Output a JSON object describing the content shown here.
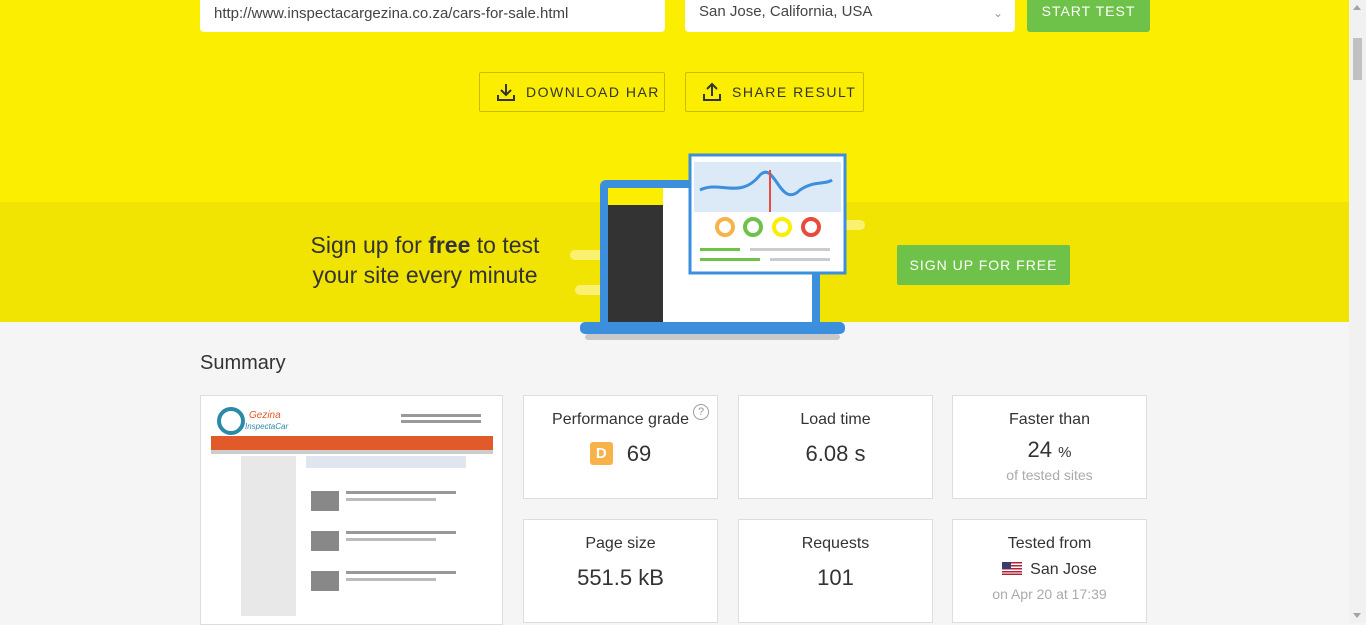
{
  "test_form": {
    "url_value": "http://www.inspectacargezina.co.za/cars-for-sale.html",
    "location": "San Jose, California, USA",
    "start_label": "START TEST"
  },
  "actions": {
    "download_label": "DOWNLOAD HAR",
    "share_label": "SHARE RESULT"
  },
  "signup": {
    "line1_pre": "Sign up for ",
    "line1_bold": "free",
    "line1_post": " to test",
    "line2": "your site every minute",
    "button_label": "SIGN UP FOR FREE"
  },
  "summary": {
    "title": "Summary",
    "thumbnail": {
      "logo_line1": "Gezina",
      "logo_line2": "InspectaCar"
    },
    "performance": {
      "label": "Performance grade",
      "grade": "D",
      "score": "69",
      "help": "?"
    },
    "load_time": {
      "label": "Load time",
      "value": "6.08 s"
    },
    "faster_than": {
      "label": "Faster than",
      "value": "24",
      "unit": "%",
      "sub": "of tested sites"
    },
    "page_size": {
      "label": "Page size",
      "value": "551.5 kB"
    },
    "requests": {
      "label": "Requests",
      "value": "101"
    },
    "tested_from": {
      "label": "Tested from",
      "value": "San Jose",
      "sub": "on Apr 20 at 17:39"
    }
  },
  "colors": {
    "yellow": "#fbee00",
    "band_yellow": "#f2e402",
    "green": "#6ec24a",
    "grade_d": "#f7b34a"
  },
  "icons": [
    "download-icon",
    "upload-icon",
    "chevron-down-icon",
    "help-icon",
    "us-flag-icon"
  ]
}
